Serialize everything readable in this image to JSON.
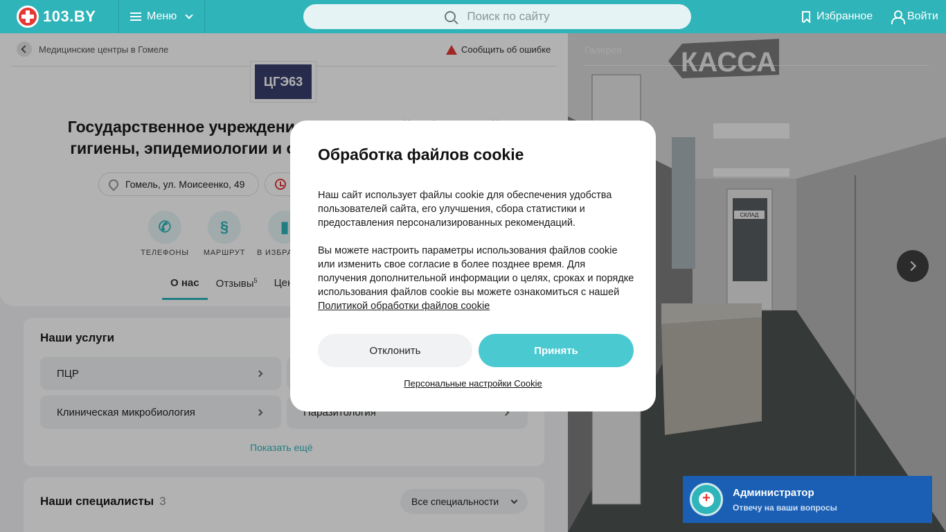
{
  "header": {
    "logo": "103.BY",
    "menu_label": "Меню",
    "search_placeholder": "Поиск по сайту",
    "favorites": "Избранное",
    "login": "Войти",
    "brand_color": "#2fb4b9"
  },
  "breadcrumb": {
    "label": "Медицинские центры в Гомеле"
  },
  "report": "Сообщить об ошибке",
  "org": {
    "logo_text": "ЦГЭ63",
    "title_line1": "Государственное учреждение «Гомельский областной",
    "title_line2": "гигиены, эпидемиологии и общественного здоровья»",
    "address": "Гомель, ул. Моисеенко, 49"
  },
  "actions": [
    {
      "label": "ТЕЛЕФОНЫ",
      "icon": "phone-icon"
    },
    {
      "label": "МАРШРУТ",
      "icon": "route-icon"
    },
    {
      "label": "В ИЗБРАННОЕ",
      "icon": "bookmark-icon"
    }
  ],
  "tabs": [
    {
      "label": "О нас"
    },
    {
      "label": "Отзывы",
      "count": "5"
    },
    {
      "label": "Цены"
    }
  ],
  "services": {
    "title": "Наши услуги",
    "items": [
      "ПЦР",
      "Клиническая микробиология",
      "Паразитология"
    ],
    "more": "Показать ещё"
  },
  "specialists": {
    "title": "Наши специалисты",
    "count": "3",
    "filter": "Все специальности"
  },
  "gallery": {
    "label": "Галерея",
    "sign_text": "КАССА",
    "door_sign": "СКЛАД"
  },
  "cookie_modal": {
    "title": "Обработка файлов cookie",
    "p1": "Наш сайт использует файлы cookie для обеспечения удобства пользователей сайта, его улучшения, сбора статистики и предоставления персонализированных рекомендаций.",
    "p2": "Вы можете настроить параметры использования файлов cookie или изменить свое согласие в более позднее время. Для получения дополнительной информации о целях, сроках и порядке использования файлов cookie вы можете ознакомиться с нашей",
    "policy_link": "Политикой обработки файлов cookie",
    "decline": "Отклонить",
    "accept": "Принять",
    "personal": "Персональные настройки Cookie"
  },
  "admin_widget": {
    "name": "Администратор",
    "subtitle": "Отвечу на ваши вопросы"
  }
}
